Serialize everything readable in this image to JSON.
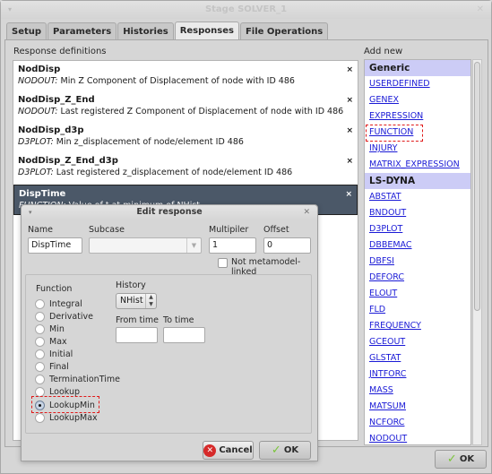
{
  "window": {
    "title": "Stage SOLVER_1",
    "menu_icon": "▾",
    "close_icon": "✕"
  },
  "tabs": [
    {
      "label": "Setup",
      "active": false
    },
    {
      "label": "Parameters",
      "active": false
    },
    {
      "label": "Histories",
      "active": false
    },
    {
      "label": "Responses",
      "active": true
    },
    {
      "label": "File Operations",
      "active": false
    }
  ],
  "responses": {
    "section_label": "Response definitions",
    "items": [
      {
        "name": "NodDisp",
        "source": "NODOUT:",
        "description": "Min Z Component of Displacement of node with ID 486",
        "selected": false
      },
      {
        "name": "NodDisp_Z_End",
        "source": "NODOUT:",
        "description": "Last registered Z Component of Displacement of node with ID 486",
        "selected": false
      },
      {
        "name": "NodDisp_d3p",
        "source": "D3PLOT:",
        "description": "Min z_displacement of node/element ID 486",
        "selected": false
      },
      {
        "name": "NodDisp_Z_End_d3p",
        "source": "D3PLOT:",
        "description": "Last registered z_displacement of node/element ID 486",
        "selected": false
      },
      {
        "name": "DispTime",
        "source": "FUNCTION:",
        "description": "Value of t at minimum of NHist",
        "selected": true
      }
    ],
    "delete_icon": "×"
  },
  "add_new": {
    "section_label": "Add new",
    "groups": [
      {
        "header": "Generic",
        "items": [
          "USERDEFINED",
          "GENEX",
          "EXPRESSION",
          "FUNCTION",
          "INJURY",
          "MATRIX_EXPRESSION"
        ]
      },
      {
        "header": "LS-DYNA",
        "items": [
          "ABSTAT",
          "BNDOUT",
          "D3PLOT",
          "DBBEMAC",
          "DBFSI",
          "DEFORC",
          "ELOUT",
          "FLD",
          "FREQUENCY",
          "GCEOUT",
          "GLSTAT",
          "JNTFORC",
          "MASS",
          "MATSUM",
          "NCFORC",
          "NODOUT"
        ]
      }
    ],
    "highlighted_item": "FUNCTION"
  },
  "main_ok_label": "OK",
  "dialog": {
    "title": "Edit response",
    "menu_icon": "▾",
    "close_icon": "✕",
    "name_label": "Name",
    "name_value": "DispTime",
    "subcase_label": "Subcase",
    "subcase_value": "",
    "multiplier_label": "Multipiler",
    "multiplier_value": "1",
    "offset_label": "Offset",
    "offset_value": "0",
    "not_metamodel_label": "Not metamodel-linked",
    "not_metamodel_checked": false,
    "function_label": "Function",
    "functions": [
      "Integral",
      "Derivative",
      "Min",
      "Max",
      "Initial",
      "Final",
      "TerminationTime",
      "Lookup",
      "LookupMin",
      "LookupMax"
    ],
    "selected_function": "LookupMin",
    "history_label": "History",
    "history_value": "NHist",
    "from_time_label": "From time",
    "from_time_value": "",
    "to_time_label": "To time",
    "to_time_value": "",
    "cancel_label": "Cancel",
    "ok_label": "OK"
  }
}
